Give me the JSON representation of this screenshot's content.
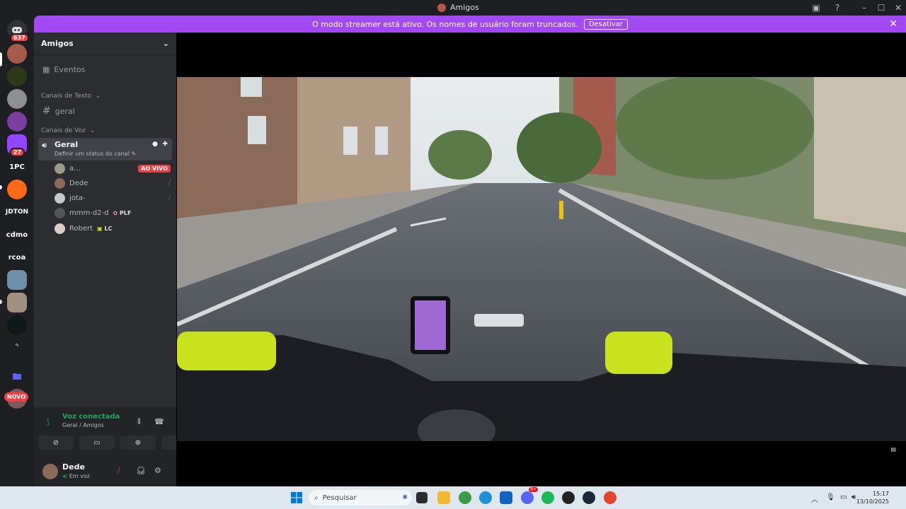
{
  "window": {
    "title": "Amigos"
  },
  "banner": {
    "message": "O modo streamer está ativo. Os nomes de usuário foram truncados.",
    "button": "Desativar"
  },
  "guilds": {
    "dm_badge": "637",
    "twitch_badge": "27",
    "labels": [
      "1PC",
      "JDTON",
      "cdmo",
      "rcoa"
    ],
    "novo": "NOVO"
  },
  "sidebar": {
    "server_name": "Amigos",
    "events": "Eventos",
    "text_category": "Canais de Texto",
    "text_channel": "geral",
    "voice_category": "Canais de Voz",
    "voice_channel": {
      "name": "Geral",
      "status": "Definir um status do canal"
    },
    "voice_users": [
      {
        "name": "a...",
        "badge": "AO VIVO"
      },
      {
        "name": "Dede"
      },
      {
        "name": "jota-"
      },
      {
        "name": "mmm-d2-d",
        "tag": "PLF"
      },
      {
        "name": "Robert",
        "tag": "LC"
      }
    ]
  },
  "voice_panel": {
    "status": "Voz conectada",
    "location": "Geral / Amigos"
  },
  "user": {
    "name": "Dede",
    "status": "Em voz"
  },
  "taskbar": {
    "search_placeholder": "Pesquisar",
    "time": "15:17",
    "date": "13/10/2025",
    "outlook_badge": "9+"
  },
  "colors": {
    "banner": "#a349f4",
    "connected": "#23a55a",
    "live": "#f23f43"
  }
}
